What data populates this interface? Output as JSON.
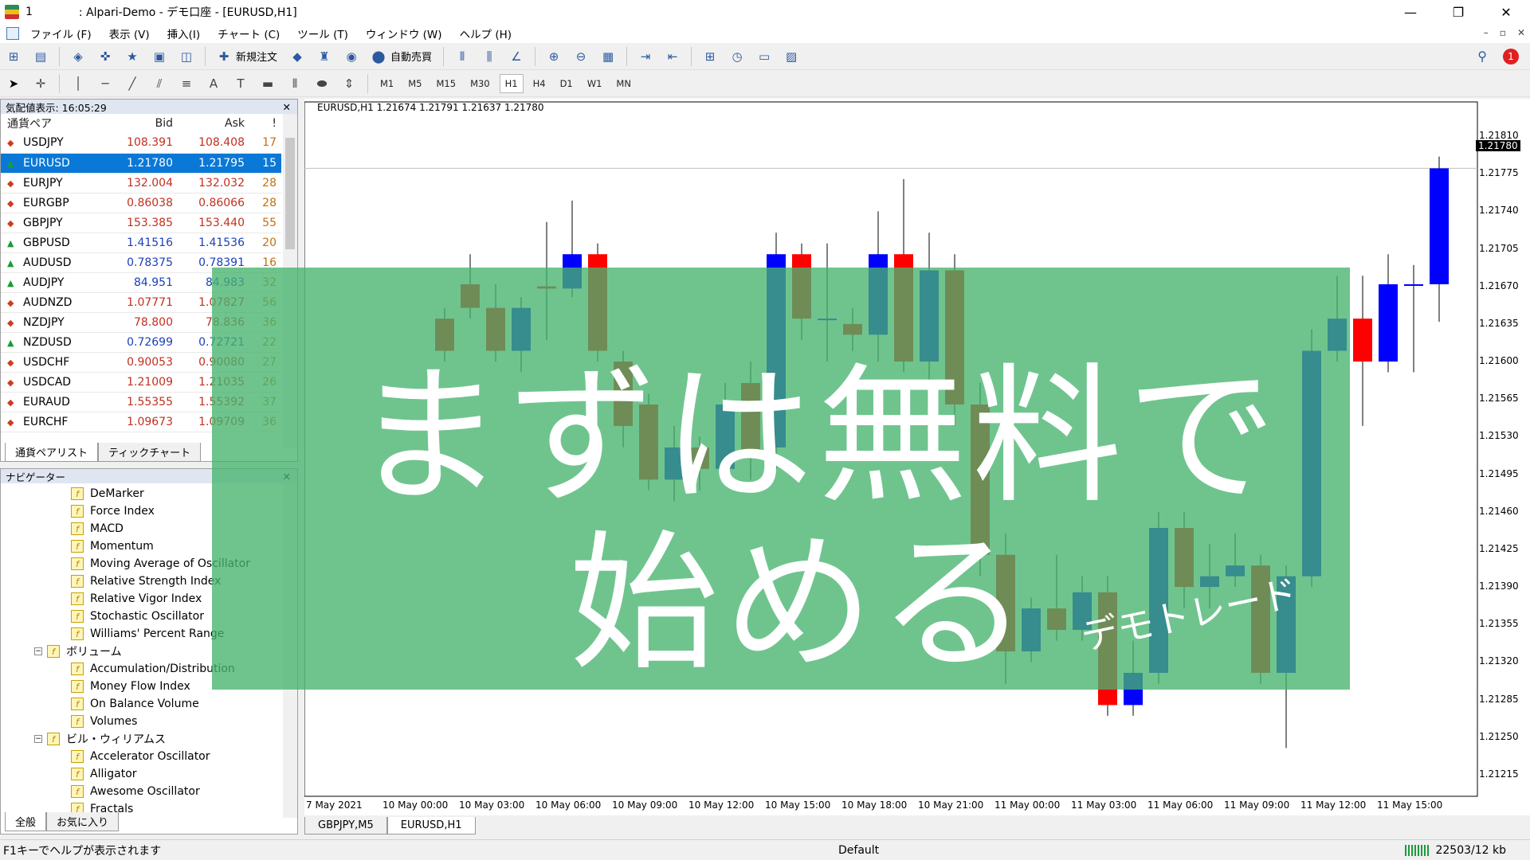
{
  "window": {
    "number": "1",
    "title": ": Alpari-Demo - デモ口座 - [EURUSD,H1]"
  },
  "menu": [
    "ファイル (F)",
    "表示 (V)",
    "挿入(I)",
    "チャート (C)",
    "ツール (T)",
    "ウィンドウ (W)",
    "ヘルプ (H)"
  ],
  "toolbar": {
    "new_order": "新規注文",
    "auto_trade": "自動売買",
    "timeframes": [
      "M1",
      "M5",
      "M15",
      "M30",
      "H1",
      "H4",
      "D1",
      "W1",
      "MN"
    ],
    "active_timeframe": "H1",
    "notification_count": "1"
  },
  "market_watch": {
    "header": "気配値表示: 16:05:29",
    "columns": [
      "通貨ペア",
      "Bid",
      "Ask",
      "!"
    ],
    "rows": [
      {
        "symbol": "USDJPY",
        "bid": "108.391",
        "ask": "108.408",
        "spread": "17",
        "dir": "down"
      },
      {
        "symbol": "EURUSD",
        "bid": "1.21780",
        "ask": "1.21795",
        "spread": "15",
        "dir": "up"
      },
      {
        "symbol": "EURJPY",
        "bid": "132.004",
        "ask": "132.032",
        "spread": "28",
        "dir": "down"
      },
      {
        "symbol": "EURGBP",
        "bid": "0.86038",
        "ask": "0.86066",
        "spread": "28",
        "dir": "down"
      },
      {
        "symbol": "GBPJPY",
        "bid": "153.385",
        "ask": "153.440",
        "spread": "55",
        "dir": "down"
      },
      {
        "symbol": "GBPUSD",
        "bid": "1.41516",
        "ask": "1.41536",
        "spread": "20",
        "dir": "up"
      },
      {
        "symbol": "AUDUSD",
        "bid": "0.78375",
        "ask": "0.78391",
        "spread": "16",
        "dir": "up"
      },
      {
        "symbol": "AUDJPY",
        "bid": "84.951",
        "ask": "84.983",
        "spread": "32",
        "dir": "up"
      },
      {
        "symbol": "AUDNZD",
        "bid": "1.07771",
        "ask": "1.07827",
        "spread": "56",
        "dir": "down"
      },
      {
        "symbol": "NZDJPY",
        "bid": "78.800",
        "ask": "78.836",
        "spread": "36",
        "dir": "down"
      },
      {
        "symbol": "NZDUSD",
        "bid": "0.72699",
        "ask": "0.72721",
        "spread": "22",
        "dir": "up"
      },
      {
        "symbol": "USDCHF",
        "bid": "0.90053",
        "ask": "0.90080",
        "spread": "27",
        "dir": "down"
      },
      {
        "symbol": "USDCAD",
        "bid": "1.21009",
        "ask": "1.21035",
        "spread": "26",
        "dir": "down"
      },
      {
        "symbol": "EURAUD",
        "bid": "1.55355",
        "ask": "1.55392",
        "spread": "37",
        "dir": "down"
      },
      {
        "symbol": "EURCHF",
        "bid": "1.09673",
        "ask": "1.09709",
        "spread": "36",
        "dir": "down"
      }
    ],
    "tabs": [
      "通貨ペアリスト",
      "ティックチャート"
    ]
  },
  "navigator": {
    "header": "ナビゲーター",
    "items": [
      {
        "label": "DeMarker",
        "type": "ind"
      },
      {
        "label": "Force Index",
        "type": "ind"
      },
      {
        "label": "MACD",
        "type": "ind"
      },
      {
        "label": "Momentum",
        "type": "ind"
      },
      {
        "label": "Moving Average of Oscillator",
        "type": "ind"
      },
      {
        "label": "Relative Strength Index",
        "type": "ind"
      },
      {
        "label": "Relative Vigor Index",
        "type": "ind"
      },
      {
        "label": "Stochastic Oscillator",
        "type": "ind"
      },
      {
        "label": "Williams' Percent Range",
        "type": "ind"
      },
      {
        "label": "ボリューム",
        "type": "folder"
      },
      {
        "label": "Accumulation/Distribution",
        "type": "ind"
      },
      {
        "label": "Money Flow Index",
        "type": "ind"
      },
      {
        "label": "On Balance Volume",
        "type": "ind"
      },
      {
        "label": "Volumes",
        "type": "ind"
      },
      {
        "label": "ビル・ウィリアムス",
        "type": "folder"
      },
      {
        "label": "Accelerator Oscillator",
        "type": "ind"
      },
      {
        "label": "Alligator",
        "type": "ind"
      },
      {
        "label": "Awesome Oscillator",
        "type": "ind"
      },
      {
        "label": "Fractals",
        "type": "ind"
      }
    ],
    "tabs": [
      "全般",
      "お気に入り"
    ]
  },
  "chart": {
    "header": "EURUSD,H1  1.21674 1.21791 1.21637 1.21780",
    "current_price": "1.21780",
    "tabs": [
      "GBPJPY,M5",
      "EURUSD,H1"
    ],
    "active_tab": "EURUSD,H1"
  },
  "chart_data": {
    "type": "candlestick",
    "symbol": "EURUSD",
    "timeframe": "H1",
    "y_ticks": [
      "1.21810",
      "1.21775",
      "1.21740",
      "1.21705",
      "1.21670",
      "1.21635",
      "1.21600",
      "1.21565",
      "1.21530",
      "1.21495",
      "1.21460",
      "1.21425",
      "1.21390",
      "1.21355",
      "1.21320",
      "1.21285",
      "1.21250",
      "1.21215"
    ],
    "ylim": [
      1.21195,
      1.2183
    ],
    "x_ticks": [
      "7 May 2021",
      "10 May 00:00",
      "10 May 03:00",
      "10 May 06:00",
      "10 May 09:00",
      "10 May 12:00",
      "10 May 15:00",
      "10 May 18:00",
      "10 May 21:00",
      "11 May 00:00",
      "11 May 03:00",
      "11 May 06:00",
      "11 May 09:00",
      "11 May 12:00",
      "11 May 15:00"
    ],
    "candles": [
      [
        1.2164,
        1.2161,
        1.2165,
        1.216
      ],
      [
        1.21672,
        1.2165,
        1.217,
        1.2164
      ],
      [
        1.2165,
        1.2161,
        1.21672,
        1.216
      ],
      [
        1.2161,
        1.2165,
        1.2166,
        1.2159
      ],
      [
        1.2167,
        1.21668,
        1.2173,
        1.2162
      ],
      [
        1.21668,
        1.217,
        1.2175,
        1.2166
      ],
      [
        1.217,
        1.2161,
        1.2171,
        1.216
      ],
      [
        1.216,
        1.2154,
        1.2161,
        1.2152
      ],
      [
        1.2156,
        1.2149,
        1.2157,
        1.2148
      ],
      [
        1.2149,
        1.2152,
        1.2154,
        1.2147
      ],
      [
        1.2152,
        1.215,
        1.2153,
        1.2148
      ],
      [
        1.215,
        1.2156,
        1.2158,
        1.2149
      ],
      [
        1.2158,
        1.2151,
        1.216,
        1.2149
      ],
      [
        1.2152,
        1.217,
        1.2172,
        1.215
      ],
      [
        1.217,
        1.2164,
        1.2171,
        1.2162
      ],
      [
        1.2164,
        1.2164,
        1.2171,
        1.216
      ],
      [
        1.21635,
        1.21625,
        1.2165,
        1.2161
      ],
      [
        1.21625,
        1.217,
        1.2174,
        1.216
      ],
      [
        1.217,
        1.216,
        1.2177,
        1.2159
      ],
      [
        1.216,
        1.21685,
        1.2172,
        1.2158
      ],
      [
        1.21685,
        1.2156,
        1.217,
        1.2154
      ],
      [
        1.2156,
        1.2142,
        1.2158,
        1.214
      ],
      [
        1.2142,
        1.2133,
        1.2144,
        1.213
      ],
      [
        1.2133,
        1.2137,
        1.2138,
        1.2132
      ],
      [
        1.2137,
        1.2135,
        1.2142,
        1.2134
      ],
      [
        1.2135,
        1.21385,
        1.214,
        1.2134
      ],
      [
        1.21385,
        1.2128,
        1.214,
        1.2127
      ],
      [
        1.2128,
        1.2131,
        1.2134,
        1.2127
      ],
      [
        1.2131,
        1.21445,
        1.2146,
        1.213
      ],
      [
        1.21445,
        1.2139,
        1.2146,
        1.2137
      ],
      [
        1.2139,
        1.214,
        1.2143,
        1.2137
      ],
      [
        1.214,
        1.2141,
        1.2144,
        1.2139
      ],
      [
        1.2141,
        1.2131,
        1.2142,
        1.213
      ],
      [
        1.2131,
        1.214,
        1.2141,
        1.2124
      ],
      [
        1.214,
        1.2161,
        1.2163,
        1.2139
      ],
      [
        1.2161,
        1.2164,
        1.2168,
        1.216
      ],
      [
        1.2164,
        1.216,
        1.2168,
        1.2154
      ],
      [
        1.216,
        1.21672,
        1.217,
        1.2159
      ],
      [
        1.21672,
        1.21672,
        1.2169,
        1.2159
      ],
      [
        1.21672,
        1.2178,
        1.21791,
        1.21637
      ]
    ]
  },
  "overlay": {
    "line1": "まずは無料で",
    "line2": "始める",
    "sub": "デモトレード"
  },
  "status": {
    "help": "F1キーでヘルプが表示されます",
    "profile": "Default",
    "traffic": "22503/12 kb"
  },
  "colors": {
    "bull": "#0000ff",
    "bear": "#ff0000",
    "overlay": "#46b46e",
    "selected_row": "#0a78d7"
  }
}
